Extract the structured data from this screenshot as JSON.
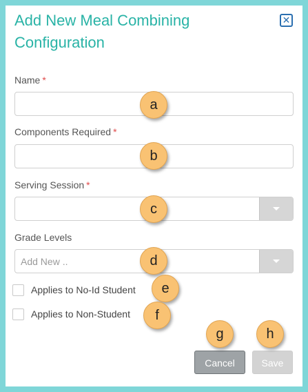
{
  "dialog": {
    "title": "Add New Meal Combining Configuration",
    "close_icon": "close-icon",
    "close_glyph": "✕"
  },
  "form": {
    "name": {
      "label": "Name",
      "required_mark": "*",
      "value": ""
    },
    "components_required": {
      "label": "Components Required",
      "required_mark": "*",
      "value": ""
    },
    "serving_session": {
      "label": "Serving Session",
      "required_mark": "*",
      "selected": ""
    },
    "grade_levels": {
      "label": "Grade Levels",
      "placeholder": "Add New .."
    },
    "no_id_student": {
      "label": "Applies to No-Id Student",
      "checked": false
    },
    "non_student": {
      "label": "Applies to Non-Student",
      "checked": false
    }
  },
  "buttons": {
    "cancel": "Cancel",
    "save": "Save"
  },
  "callouts": {
    "a": "a",
    "b": "b",
    "c": "c",
    "d": "d",
    "e": "e",
    "f": "f",
    "g": "g",
    "h": "h"
  },
  "colors": {
    "title": "#29b3a6",
    "frame": "#7fd6d8",
    "required": "#e04a4a",
    "callout": "#f9c273"
  }
}
